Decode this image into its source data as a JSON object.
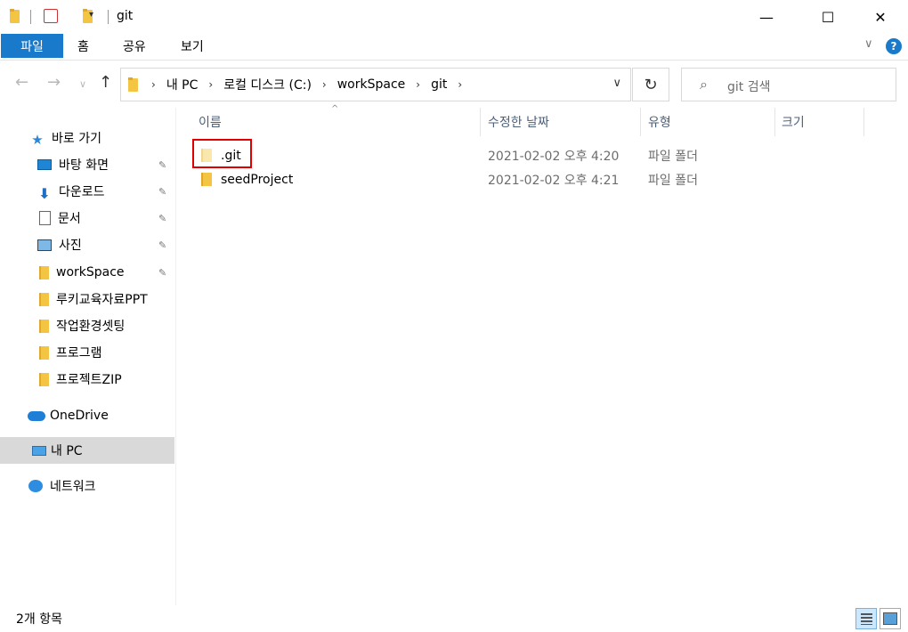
{
  "window": {
    "title": "git",
    "minimize_glyph": "—",
    "maximize_glyph": "☐",
    "close_glyph": "✕"
  },
  "ribbon": {
    "tabs": [
      {
        "label": "파일",
        "active": true
      },
      {
        "label": "홈"
      },
      {
        "label": "공유"
      },
      {
        "label": "보기"
      }
    ],
    "help_label": "?",
    "collapse_glyph": "∨"
  },
  "nav": {
    "back_glyph": "←",
    "forward_glyph": "→",
    "recent_glyph": "∨",
    "up_glyph": "↑",
    "breadcrumbs": [
      "내 PC",
      "로컬 디스크 (C:)",
      "workSpace",
      "git"
    ],
    "crumb_separator": "›",
    "dropdown_glyph": "∨",
    "refresh_glyph": "↻",
    "search_placeholder": "git 검색"
  },
  "sidebar": {
    "items": [
      {
        "label": "바로 가기",
        "icon": "star-icon",
        "pinned": false
      },
      {
        "label": "바탕 화면",
        "icon": "desktop-icon",
        "pinned": true
      },
      {
        "label": "다운로드",
        "icon": "download-icon",
        "pinned": true
      },
      {
        "label": "문서",
        "icon": "document-icon",
        "pinned": true
      },
      {
        "label": "사진",
        "icon": "picture-icon",
        "pinned": true
      },
      {
        "label": "workSpace",
        "icon": "folder-icon",
        "pinned": true
      },
      {
        "label": "루키교육자료PPT",
        "icon": "folder-icon",
        "pinned": false
      },
      {
        "label": "작업환경셋팅",
        "icon": "folder-icon",
        "pinned": false
      },
      {
        "label": "프로그램",
        "icon": "folder-icon",
        "pinned": false
      },
      {
        "label": "프로젝트ZIP",
        "icon": "folder-icon",
        "pinned": false
      },
      {
        "label": "OneDrive",
        "icon": "cloud-icon",
        "pinned": false
      },
      {
        "label": "내 PC",
        "icon": "computer-icon",
        "pinned": false,
        "selected": true
      },
      {
        "label": "네트워크",
        "icon": "network-icon",
        "pinned": false
      }
    ],
    "pin_glyph": "📌"
  },
  "file_list": {
    "columns": [
      "이름",
      "수정한 날짜",
      "유형",
      "크기"
    ],
    "sort_glyph": "^",
    "rows": [
      {
        "name": ".git",
        "modified": "2021-02-02 오후 4:20",
        "type": "파일 폴더",
        "size": "",
        "hidden": true
      },
      {
        "name": "seedProject",
        "modified": "2021-02-02 오후 4:21",
        "type": "파일 폴더",
        "size": "",
        "hidden": false
      }
    ]
  },
  "status": {
    "item_count": "2개 항목"
  },
  "colors": {
    "accent": "#1979ca",
    "highlight_box": "#e00000",
    "selection": "#d9d9d9",
    "folder": "#f4c542"
  }
}
